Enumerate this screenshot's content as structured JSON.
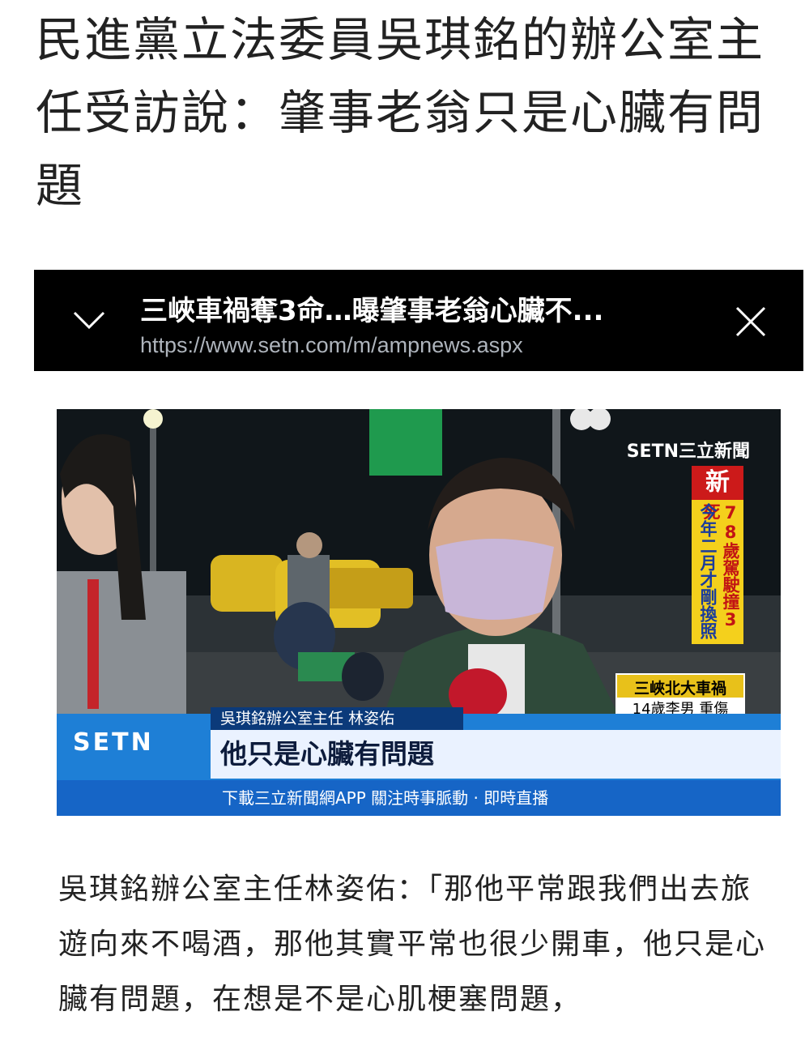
{
  "article": {
    "headline": "民進黨立法委員吳琪銘的辦公室主任受訪說：肇事老翁只是心臟有問題",
    "body": "吳琪銘辦公室主任林姿佑：「那他平常跟我們出去旅遊向來不喝酒，那他其實平常也很少開車，他只是心臟有問題，在想是不是心肌梗塞問題，"
  },
  "amp_bar": {
    "title": "三峽車禍奪3命…曝肇事老翁心臟不...",
    "url": "https://www.setn.com/m/ampnews.aspx",
    "collapse_icon": "chevron-down-icon",
    "close_icon": "close-icon"
  },
  "news_still": {
    "channel_logo": "SETN三立新聞",
    "new_badge": "新",
    "vertical_red": "78歲駕駛撞3死",
    "vertical_blue": "今年二月才剛換照",
    "location_line1": "三峽北大車禍",
    "location_line2": "14歲李男 重傷",
    "name_caption": "吳琪銘辦公室主任 林姿佑",
    "quote_caption": "他只是心臟有問題",
    "bottom_logo": "SETN",
    "ticker": "下載三立新聞網APP 關注時事脈動 · 即時直播"
  },
  "colors": {
    "amp_bar_bg": "#000000",
    "lower_third_blue": "#1e7fd6",
    "badge_red": "#cc1a1a",
    "strip_yellow": "#f4d01c"
  }
}
